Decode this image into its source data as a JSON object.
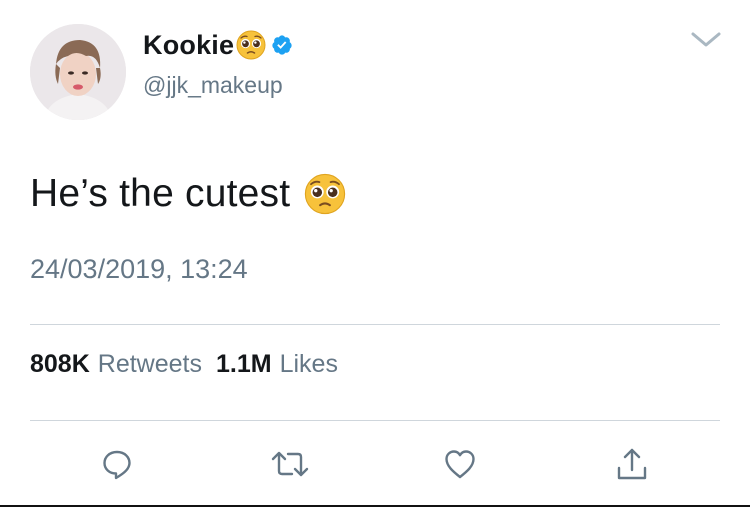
{
  "tweet": {
    "display_name": "Kookie",
    "handle": "@jjk_makeup",
    "text": "He’s the cutest",
    "timestamp": "24/03/2019, 13:24",
    "stats": {
      "retweets_count": "808K",
      "retweets_label": "Retweets",
      "likes_count": "1.1M",
      "likes_label": "Likes"
    }
  },
  "icons": {
    "name_emoji": "pleading-face-emoji",
    "verified": "verified-badge-icon",
    "caret": "chevron-down-icon",
    "text_emoji": "pleading-face-emoji",
    "actions": [
      "reply-icon",
      "retweet-icon",
      "like-icon",
      "share-icon"
    ]
  },
  "colors": {
    "text_primary": "#14171a",
    "text_secondary": "#657786",
    "verified_blue": "#1da1f2",
    "icon_gray": "#657786",
    "divider": "#cfd6dc",
    "emoji_yellow": "#f7c23b"
  }
}
